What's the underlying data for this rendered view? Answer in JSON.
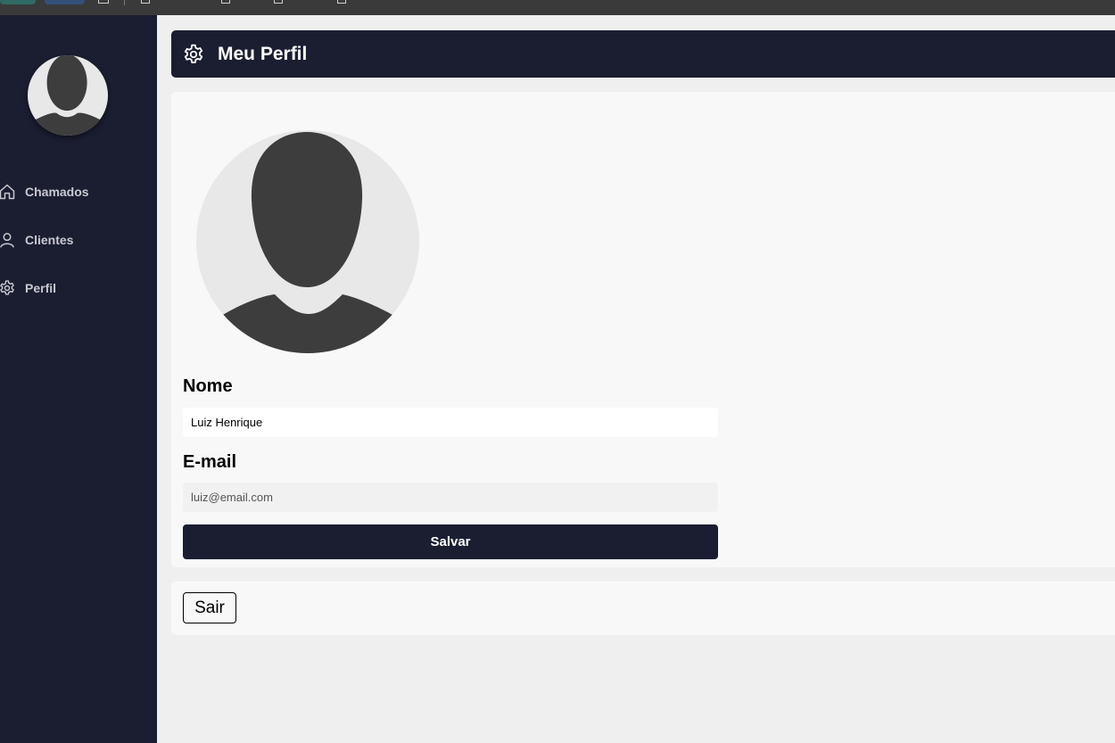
{
  "sidebar": {
    "items": [
      {
        "label": "Chamados",
        "icon": "home-icon"
      },
      {
        "label": "Clientes",
        "icon": "user-icon"
      },
      {
        "label": "Perfil",
        "icon": "gear-icon"
      }
    ]
  },
  "header": {
    "title": "Meu Perfil",
    "icon": "gear-icon"
  },
  "profile": {
    "name_label": "Nome",
    "name_value": "Luiz Henrique",
    "email_label": "E-mail",
    "email_placeholder": "luiz@email.com",
    "save_label": "Salvar"
  },
  "logout": {
    "label": "Sair"
  },
  "colors": {
    "sidebar_bg": "#1b1d31",
    "page_bg": "#efefef",
    "card_bg": "#f8f8f8",
    "avatar_bg": "#e8e8e8",
    "avatar_fg": "#3d3d3d"
  }
}
